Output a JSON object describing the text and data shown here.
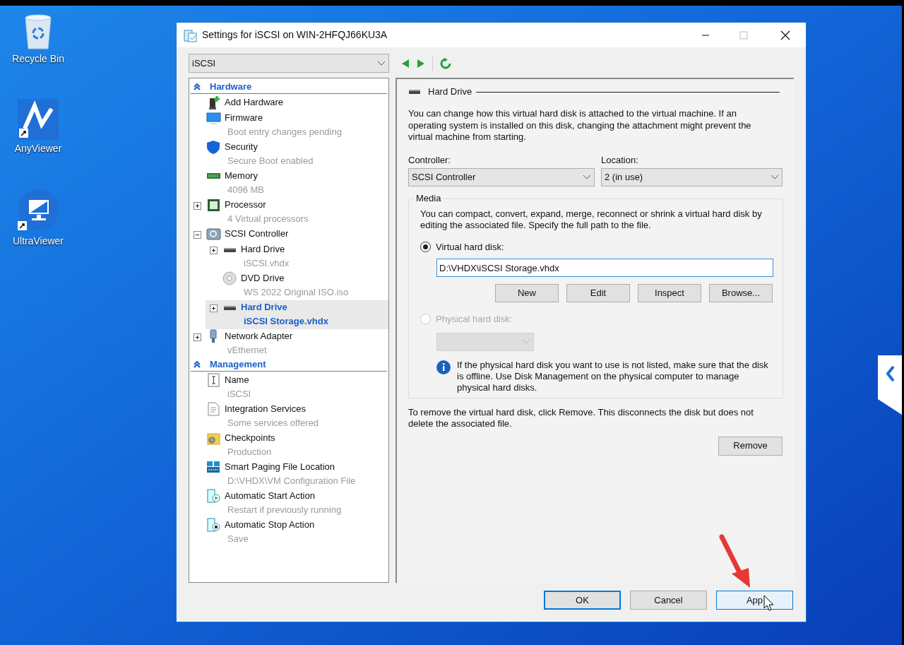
{
  "desktop_icons": [
    {
      "label": "Recycle Bin",
      "kind": "recycle"
    },
    {
      "label": "AnyViewer",
      "kind": "anyviewer"
    },
    {
      "label": "UltraViewer",
      "kind": "ultraviewer"
    }
  ],
  "window": {
    "title": "Settings for iSCSI on WIN-2HFQJ66KU3A"
  },
  "vm_selector": {
    "value": "iSCSI"
  },
  "tree": [
    {
      "label": "Hardware",
      "items": [
        {
          "label": "Add Hardware",
          "kind": "add-hardware",
          "selected": false
        },
        {
          "label": "Firmware",
          "detail": "Boot entry changes pending",
          "kind": "firmware",
          "selected": false
        },
        {
          "label": "Security",
          "detail": "Secure Boot enabled",
          "kind": "security",
          "selected": false
        },
        {
          "label": "Memory",
          "detail": "4096 MB",
          "kind": "memory",
          "selected": false
        },
        {
          "label": "Processor",
          "detail": "4 Virtual processors",
          "kind": "processor",
          "selected": false,
          "expanded": false
        },
        {
          "label": "SCSI Controller",
          "kind": "controller",
          "selected": false,
          "expanded": true,
          "children": [
            {
              "label": "Hard Drive",
              "detail": "iSCSI.vhdx",
              "kind": "drive",
              "selected": false,
              "expanded": false
            },
            {
              "label": "DVD Drive",
              "detail": "WS 2022 Original ISO.iso",
              "kind": "dvd",
              "selected": false
            },
            {
              "label": "Hard Drive",
              "detail": "iSCSI Storage.vhdx",
              "kind": "drive",
              "selected": true,
              "expanded": false
            }
          ]
        },
        {
          "label": "Network Adapter",
          "detail": "vEthernet",
          "kind": "network",
          "selected": false,
          "expanded": false
        }
      ]
    },
    {
      "label": "Management",
      "items": [
        {
          "label": "Name",
          "detail": "iSCSI",
          "kind": "name",
          "selected": false
        },
        {
          "label": "Integration Services",
          "detail": "Some services offered",
          "kind": "integration",
          "selected": false
        },
        {
          "label": "Checkpoints",
          "detail": "Production",
          "kind": "checkpoints",
          "selected": false
        },
        {
          "label": "Smart Paging File Location",
          "detail": "D:\\VHDX\\VM Configuration File",
          "kind": "paging",
          "selected": false
        },
        {
          "label": "Automatic Start Action",
          "detail": "Restart if previously running",
          "kind": "start",
          "selected": false
        },
        {
          "label": "Automatic Stop Action",
          "detail": "Save",
          "kind": "stop",
          "selected": false
        }
      ]
    }
  ],
  "details": {
    "title": "Hard Drive",
    "intro": "You can change how this virtual hard disk is attached to the virtual machine. If an operating system is installed on this disk, changing the attachment might prevent the virtual machine from starting.",
    "controller": {
      "label": "Controller:",
      "value": "SCSI Controller"
    },
    "location": {
      "label": "Location:",
      "value": "2 (in use)"
    },
    "media": {
      "title": "Media",
      "description": "You can compact, convert, expand, merge, reconnect or shrink a virtual hard disk by editing the associated file. Specify the full path to the file.",
      "options": [
        {
          "label": "Virtual hard disk:",
          "selected": true,
          "disabled": false
        },
        {
          "label": "Physical hard disk:",
          "selected": false,
          "disabled": true
        }
      ],
      "path": "D:\\VHDX\\iSCSI Storage.vhdx",
      "file_buttons": [
        "New",
        "Edit",
        "Inspect",
        "Browse..."
      ],
      "info": "If the physical hard disk you want to use is not listed, make sure that the disk is offline. Use Disk Management on the physical computer to manage physical hard disks."
    },
    "remove_note": "To remove the virtual hard disk, click Remove. This disconnects the disk but does not delete the associated file.",
    "remove_button": "Remove"
  },
  "buttons": [
    {
      "label": "OK",
      "kind": "default"
    },
    {
      "label": "Cancel",
      "kind": "normal"
    },
    {
      "label": "App",
      "kind": "hover"
    }
  ]
}
